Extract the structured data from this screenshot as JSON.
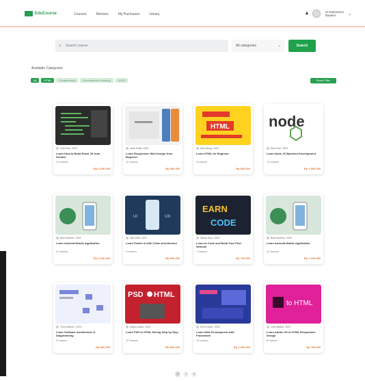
{
  "brand": {
    "name": "EduCourse"
  },
  "nav": [
    "Courses",
    "Mentors",
    "My Purchases",
    "Library"
  ],
  "user": {
    "name": "Hi Gianmarco",
    "role": "Student"
  },
  "search": {
    "placeholder": "Search course",
    "category": "All categories",
    "button": "Search"
  },
  "filters": {
    "label": "Available Categories",
    "chips": [
      {
        "label": "All",
        "active": true
      },
      {
        "label": "HTML",
        "active": true
      },
      {
        "label": "Programming",
        "active": false
      },
      {
        "label": "Development Learning",
        "active": false
      },
      {
        "label": "UI/UX",
        "active": false
      }
    ],
    "clear": "Reset Filter"
  },
  "courses": [
    {
      "author": "John Doe",
      "date": "2023",
      "title": "Learn How to Build React JS from Scratch",
      "lessons": "12 Lessons",
      "price": "Rp 1.200.000",
      "thumb": "code-dark"
    },
    {
      "author": "Jane Smith",
      "date": "2023",
      "title": "Learn Responsive Web Design from Beginner",
      "lessons": "10 Lessons",
      "price": "Rp 950.000",
      "thumb": "mobile-white"
    },
    {
      "author": "Alex Wong",
      "date": "2023",
      "title": "Learn HTML for Beginner",
      "lessons": "8 Lessons",
      "price": "Rp 800.000",
      "thumb": "html-yellow"
    },
    {
      "author": "Rina Putri",
      "date": "2023",
      "title": "Learn Node JS Backend Development",
      "lessons": "14 Lessons",
      "price": "Rp 1.500.000",
      "thumb": "node-white"
    },
    {
      "author": "Budi Santoso",
      "date": "2023",
      "title": "Learn Android Mobile Application",
      "lessons": "11 Lessons",
      "price": "Rp 1.100.000",
      "thumb": "phone-green"
    },
    {
      "author": "Sari Dewi",
      "date": "2023",
      "title": "Learn Flutter UI with Clean Architecture",
      "lessons": "9 Lessons",
      "price": "Rp 900.000",
      "thumb": "phone-blue"
    },
    {
      "author": "Dimas Arya",
      "date": "2023",
      "title": "Learn to Code and Build Your First Website",
      "lessons": "7 Lessons",
      "price": "Rp 700.000",
      "thumb": "learn-code"
    },
    {
      "author": "Budi Santoso",
      "date": "2023",
      "title": "Learn Android Mobile Application",
      "lessons": "11 Lessons",
      "price": "Rp 1.100.000",
      "thumb": "phone-green"
    },
    {
      "author": "Tono Hartono",
      "date": "2023",
      "title": "Learn Software Architecture & Diagramming",
      "lessons": "6 Lessons",
      "price": "Rp 650.000",
      "thumb": "diagram-light"
    },
    {
      "author": "Maya Lestari",
      "date": "2023",
      "title": "Learn PSD to HTML Slicing Step by Step",
      "lessons": "10 Lessons",
      "price": "Rp 850.000",
      "thumb": "psd-red"
    },
    {
      "author": "Kevin Halim",
      "date": "2023",
      "title": "Learn Web Development with Framework",
      "lessons": "13 Lessons",
      "price": "Rp 1.300.000",
      "thumb": "web-blue"
    },
    {
      "author": "Lina Marlina",
      "date": "2023",
      "title": "Learn Adobe XD to HTML Responsive Design",
      "lessons": "8 Lessons",
      "price": "Rp 780.000",
      "thumb": "xd-pink"
    }
  ],
  "pager": [
    "1",
    "2",
    "3"
  ]
}
